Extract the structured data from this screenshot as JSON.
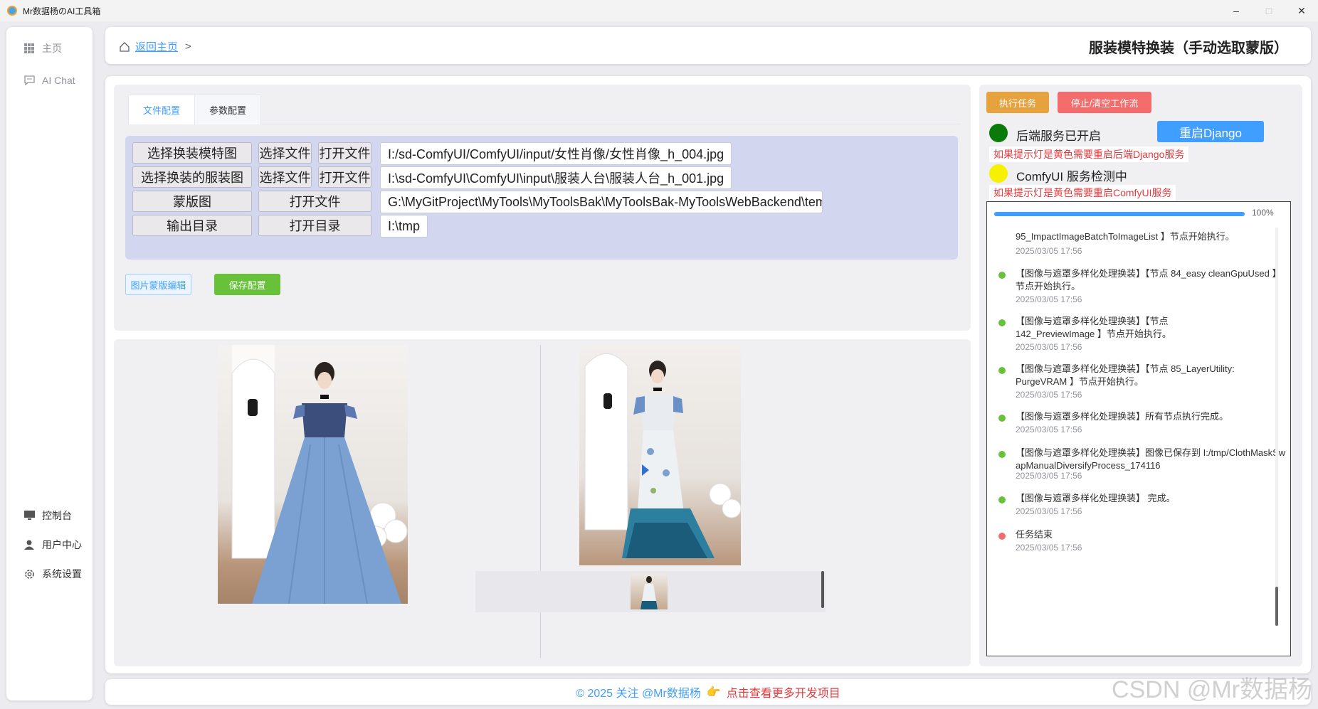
{
  "window": {
    "title": "Mr数据杨のAI工具箱",
    "minimize": "–",
    "maximize": "□",
    "close": "✕"
  },
  "sidebar": {
    "top_items": [
      {
        "label": "主页",
        "icon": "grid-icon"
      },
      {
        "label": "AI Chat",
        "icon": "chat-icon"
      }
    ],
    "bottom_items": [
      {
        "label": "控制台",
        "icon": "monitor-icon"
      },
      {
        "label": "用户中心",
        "icon": "user-icon"
      },
      {
        "label": "系统设置",
        "icon": "gear-icon"
      }
    ]
  },
  "header": {
    "back_link": "返回主页",
    "separator": ">",
    "title": "服装模特换装（手动选取蒙版）"
  },
  "config": {
    "tabs": [
      "文件配置",
      "参数配置"
    ],
    "active_tab": "文件配置",
    "rows": [
      {
        "label": "选择换装模特图",
        "select": "选择文件",
        "open": "打开文件",
        "path": "I:/sd-ComfyUI/ComfyUI/input/女性肖像/女性肖像_h_004.jpg"
      },
      {
        "label": "选择换装的服装图",
        "select": "选择文件",
        "open": "打开文件",
        "path": "I:\\sd-ComfyUI\\ComfyUI\\input\\服装人台\\服装人台_h_001.jpg"
      },
      {
        "label": "蒙版图",
        "open": "打开文件",
        "path": "G:\\MyGitProject\\MyTools\\MyToolsBak\\MyToolsBak-MyToolsWebBackend\\temp_dir\\mas…"
      },
      {
        "label": "输出目录",
        "open": "打开目录",
        "path": "I:\\tmp"
      }
    ],
    "edit_button": "图片蒙版编辑",
    "save_button": "保存配置"
  },
  "control": {
    "execute": "执行任务",
    "stop": "停止/清空工作流",
    "backend_status": "后端服务已开启",
    "backend_light": "#0a7a0a",
    "restart_django": "重启Django",
    "django_warning": "如果提示灯是黄色需要重启后端Django服务",
    "comfy_status": "ComfyUI 服务检测中",
    "comfy_light": "#f7f000",
    "comfy_warning": "如果提示灯是黄色需要重启ComfyUI服务"
  },
  "progress": {
    "percent": 100,
    "label": "100%"
  },
  "logs": [
    {
      "msg": "95_ImpactImageBatchToImageList 】节点开始执行。",
      "time": "2025/03/05 17:56",
      "color": "#67c23a",
      "partial": true
    },
    {
      "msg": "【图像与遮罩多样化处理换装】【节点 84_easy cleanGpuUsed 】节点开始执行。",
      "time": "2025/03/05 17:56",
      "color": "#67c23a"
    },
    {
      "msg": "【图像与遮罩多样化处理换装】【节点 142_PreviewImage 】节点开始执行。",
      "time": "2025/03/05 17:56",
      "color": "#67c23a"
    },
    {
      "msg": "【图像与遮罩多样化处理换装】【节点 85_LayerUtility: PurgeVRAM 】节点开始执行。",
      "time": "2025/03/05 17:56",
      "color": "#67c23a"
    },
    {
      "msg": "【图像与遮罩多样化处理换装】所有节点执行完成。",
      "time": "2025/03/05 17:56",
      "color": "#67c23a"
    },
    {
      "msg": "【图像与遮罩多样化处理换装】图像已保存到 I:/tmp/ClothMaskSwapManualDiversifyProcess_174116",
      "time": "2025/03/05 17:56",
      "color": "#67c23a"
    },
    {
      "msg": "【图像与遮罩多样化处理换装】 完成。",
      "time": "2025/03/05 17:56",
      "color": "#67c23a"
    },
    {
      "msg": "任务结束",
      "time": "2025/03/05 17:56",
      "color": "#f56c6c"
    }
  ],
  "footer": {
    "copyright": "© 2025 关注 @Mr数据杨",
    "hand": "👉",
    "more": "点击查看更多开发项目"
  },
  "watermark": "CSDN @Mr数据杨"
}
